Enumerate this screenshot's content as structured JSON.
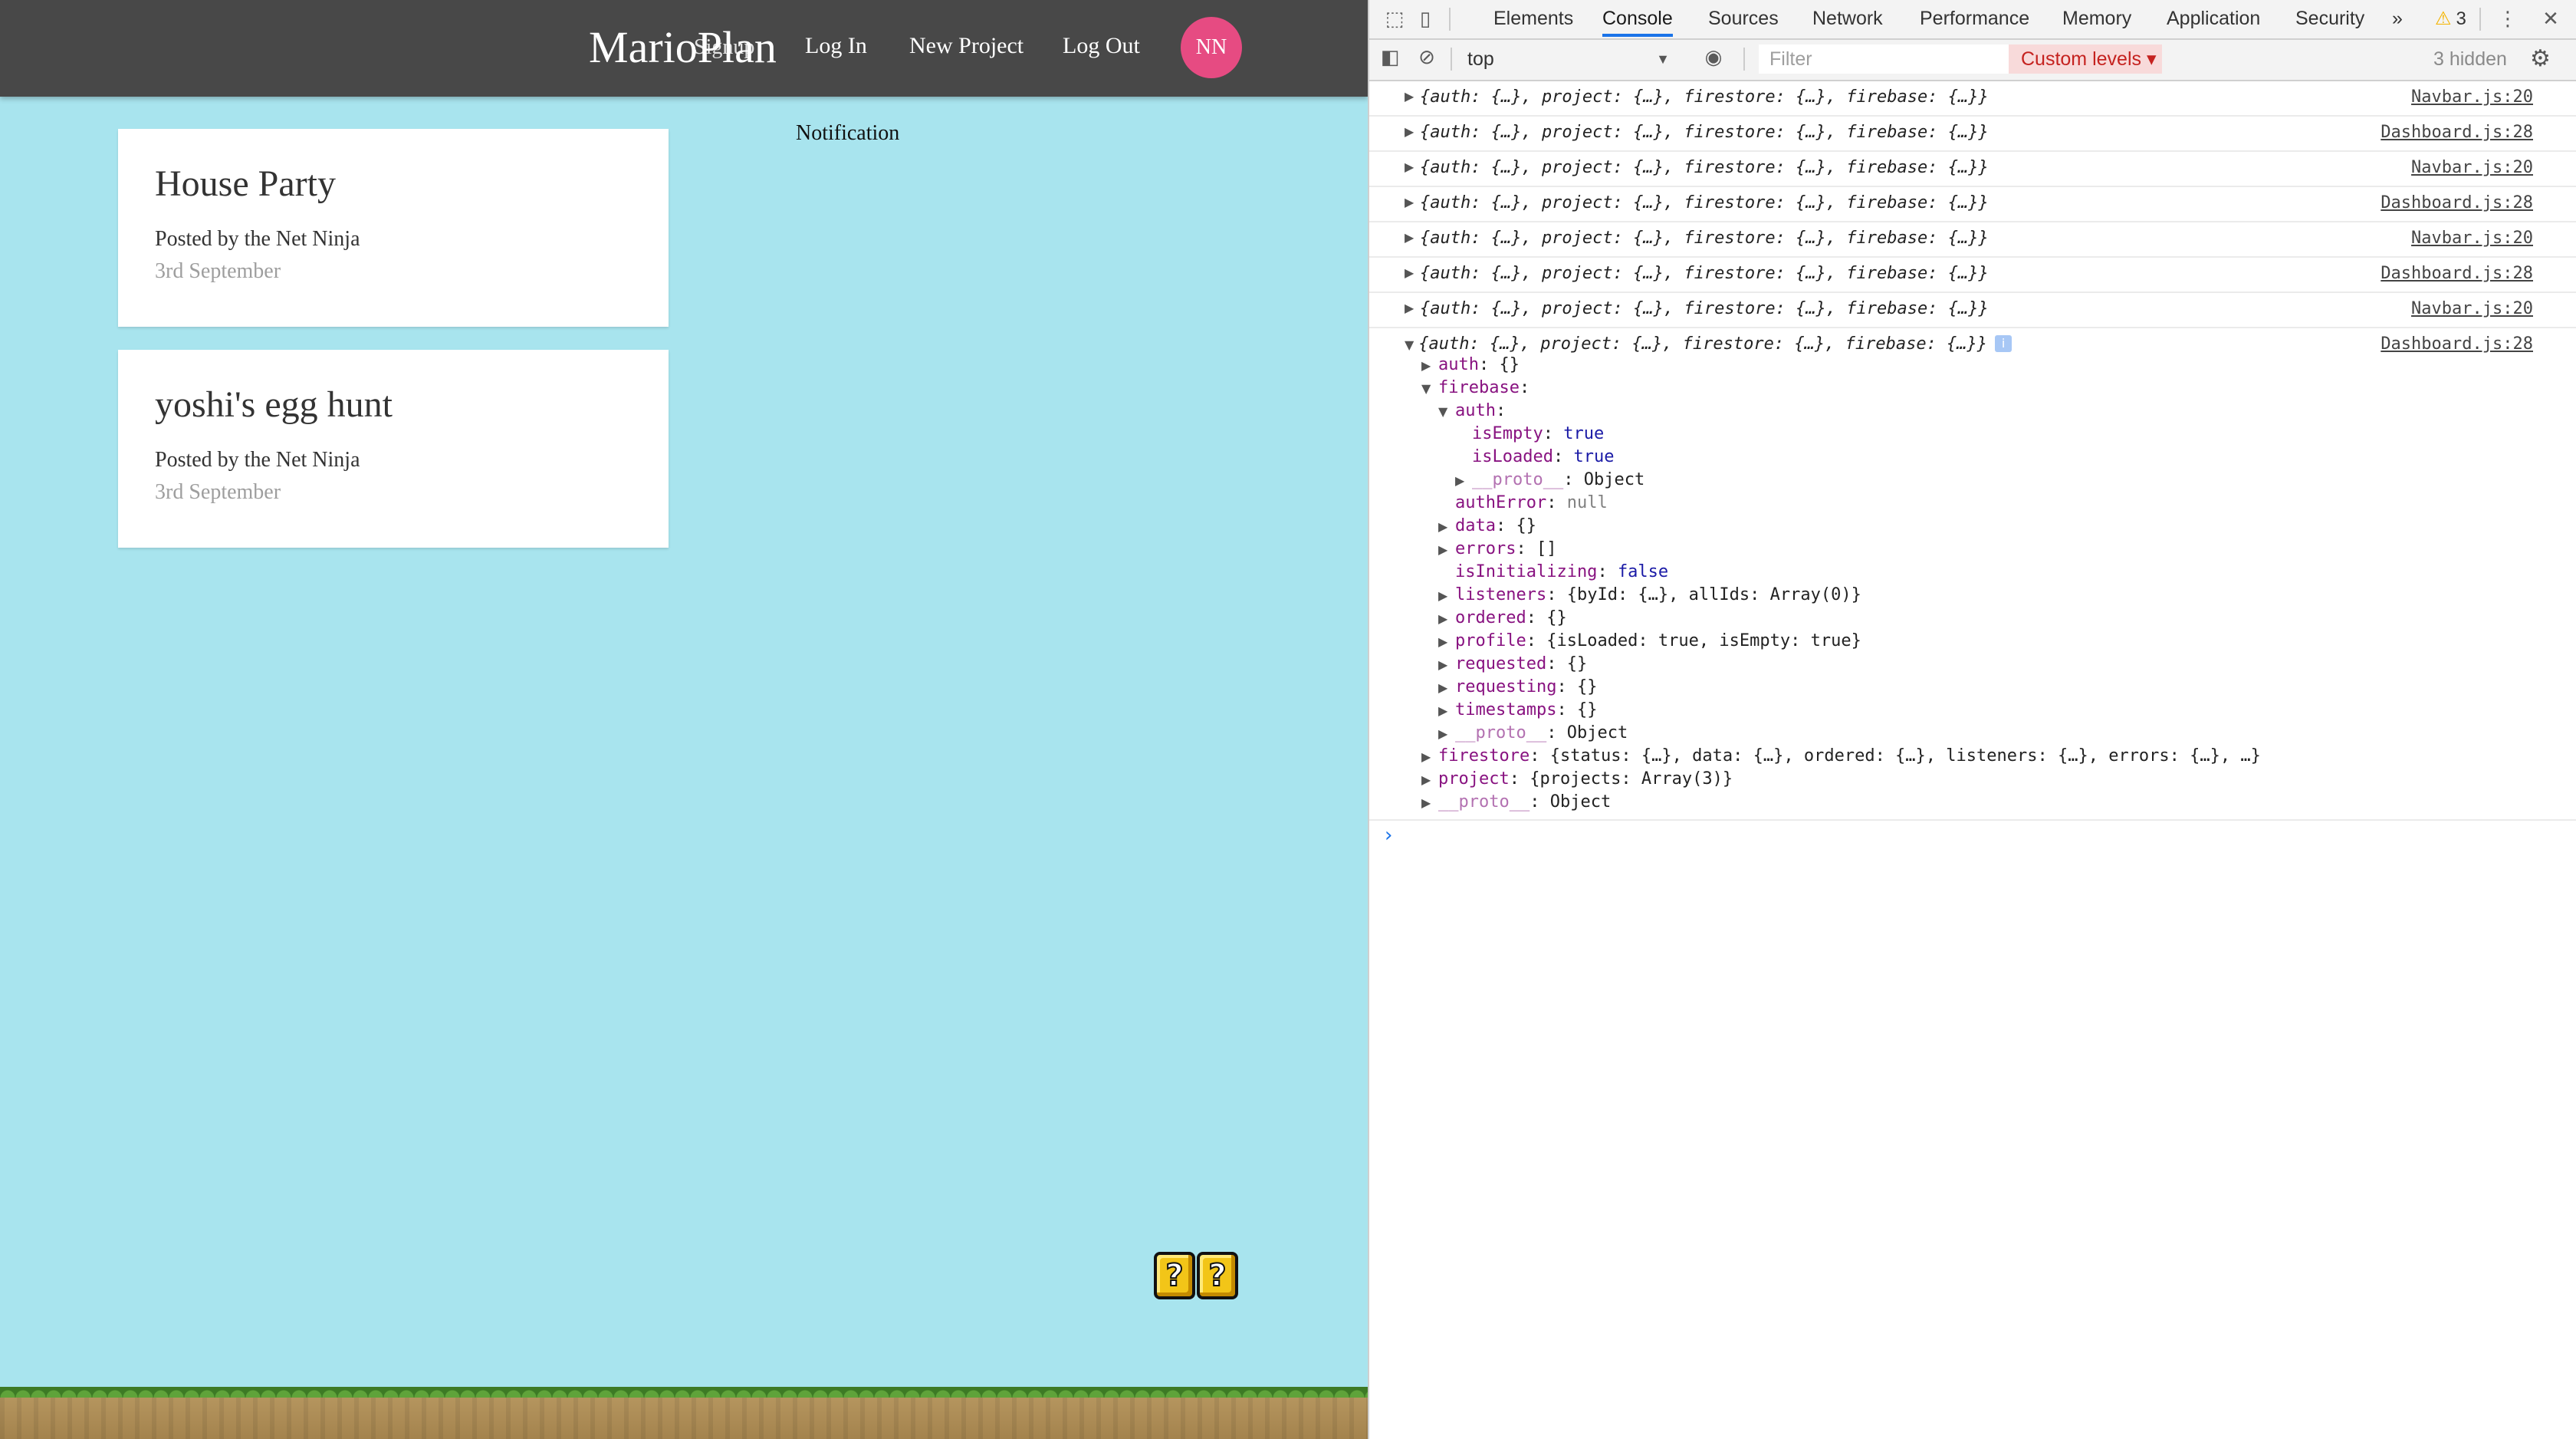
{
  "app": {
    "brand": "MarioPlan",
    "brand_overlap": "Signup",
    "nav": [
      "Log In",
      "New Project",
      "Log Out"
    ],
    "avatar_initials": "NN",
    "projects": [
      {
        "title": "House Party",
        "author": "Posted by the Net Ninja",
        "date": "3rd September"
      },
      {
        "title": "yoshi's egg hunt",
        "author": "Posted by the Net Ninja",
        "date": "3rd September"
      }
    ],
    "notifications_title": "Notification",
    "question_mark": "?"
  },
  "devtools": {
    "tabs": [
      "Elements",
      "Console",
      "Sources",
      "Network",
      "Performance",
      "Memory",
      "Application",
      "Security"
    ],
    "more_tabs": "»",
    "warning_count": "3",
    "context": "top",
    "filter_placeholder": "Filter",
    "levels": "Custom levels ▾",
    "hidden": "3 hidden",
    "log_message": "{auth: {…}, project: {…}, firestore: {…}, firebase: {…}}",
    "logs": [
      {
        "source": "Navbar.js:20"
      },
      {
        "source": "Dashboard.js:28"
      },
      {
        "source": "Navbar.js:20"
      },
      {
        "source": "Dashboard.js:28"
      },
      {
        "source": "Navbar.js:20"
      },
      {
        "source": "Dashboard.js:28"
      },
      {
        "source": "Navbar.js:20"
      }
    ],
    "expanded": {
      "source": "Dashboard.js:28",
      "info": "i",
      "lines": [
        {
          "indent": 0,
          "tw": "▶",
          "key": "auth",
          "val": "{}"
        },
        {
          "indent": 0,
          "tw": "▼",
          "key": "firebase",
          "val": ""
        },
        {
          "indent": 1,
          "tw": "▼",
          "key": "auth",
          "val": ""
        },
        {
          "indent": 2,
          "tw": "",
          "key": "isEmpty",
          "val": "true",
          "vcls": "vb"
        },
        {
          "indent": 2,
          "tw": "",
          "key": "isLoaded",
          "val": "true",
          "vcls": "vb"
        },
        {
          "indent": 2,
          "tw": "▶",
          "key": "__proto__",
          "val": "Object",
          "kcls": "kd"
        },
        {
          "indent": 1,
          "tw": "",
          "key": "authError",
          "val": "null",
          "vcls": "vn"
        },
        {
          "indent": 1,
          "tw": "▶",
          "key": "data",
          "val": "{}"
        },
        {
          "indent": 1,
          "tw": "▶",
          "key": "errors",
          "val": "[]"
        },
        {
          "indent": 1,
          "tw": "",
          "key": "isInitializing",
          "val": "false",
          "vcls": "vb"
        },
        {
          "indent": 1,
          "tw": "▶",
          "key": "listeners",
          "val": "{byId: {…}, allIds: Array(0)}"
        },
        {
          "indent": 1,
          "tw": "▶",
          "key": "ordered",
          "val": "{}"
        },
        {
          "indent": 1,
          "tw": "▶",
          "key": "profile",
          "val": "{isLoaded: true, isEmpty: true}"
        },
        {
          "indent": 1,
          "tw": "▶",
          "key": "requested",
          "val": "{}"
        },
        {
          "indent": 1,
          "tw": "▶",
          "key": "requesting",
          "val": "{}"
        },
        {
          "indent": 1,
          "tw": "▶",
          "key": "timestamps",
          "val": "{}"
        },
        {
          "indent": 1,
          "tw": "▶",
          "key": "__proto__",
          "val": "Object",
          "kcls": "kd"
        },
        {
          "indent": 0,
          "tw": "▶",
          "key": "firestore",
          "val": "{status: {…}, data: {…}, ordered: {…}, listeners: {…}, errors: {…}, …}"
        },
        {
          "indent": 0,
          "tw": "▶",
          "key": "project",
          "val": "{projects: Array(3)}"
        },
        {
          "indent": 0,
          "tw": "▶",
          "key": "__proto__",
          "val": "Object",
          "kcls": "kd"
        }
      ]
    },
    "prompt": "›"
  },
  "colors": {
    "page_bg": "#a8e4ee",
    "navbar": "#484848",
    "avatar": "#e64b82",
    "accent": "#1a73e8"
  }
}
